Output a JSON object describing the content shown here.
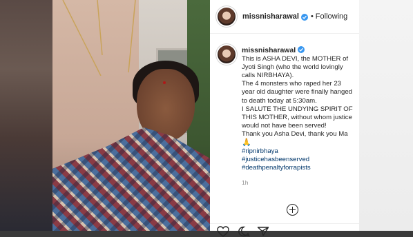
{
  "post": {
    "username": "missnisharawal",
    "follow_dot": "•",
    "follow_label": "Following",
    "caption_lines": [
      "This is ASHA DEVI, the MOTHER of",
      "Jyoti Singh (who the world lovingly",
      "calls NIRBHAYA).",
      "The 4 monsters who raped her 23",
      "year old daughter were finally hanged",
      "to death today at 5:30am.",
      "I SALUTE THE UNDYING SPIRIT OF",
      "THIS MOTHER, without whom justice",
      "would not have been served!",
      "Thank you Asha Devi, thank you Ma"
    ],
    "emoji": "🙏",
    "hashtags": [
      "#ripnirbhaya",
      "#justicehasbeenserved",
      "#deathpenaltyforrapists"
    ],
    "time": "1h"
  },
  "icons": {
    "verified": "verified-badge-icon",
    "add_comment": "plus-circle-icon",
    "like": "heart-icon",
    "comment": "comment-icon",
    "share": "share-icon"
  },
  "colors": {
    "verified": "#3897f0",
    "hashtag": "#00376b",
    "muted": "#8e8e8e"
  }
}
